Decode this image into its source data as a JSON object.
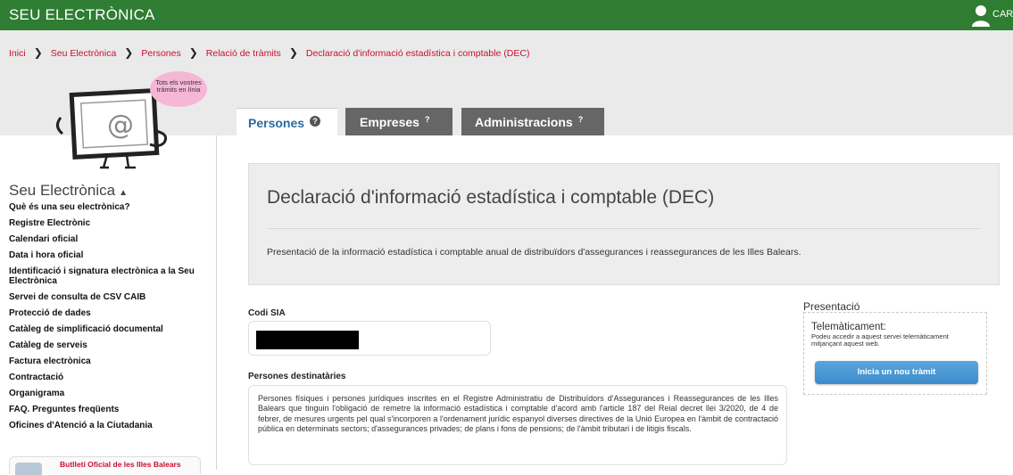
{
  "topbar": {
    "brand": "SEU ELECTRÒNICA",
    "user_label": "CAR",
    "user_icon": "user-silhouette-icon"
  },
  "breadcrumb": {
    "items": [
      "Inici",
      "Seu Electrònica",
      "Persones",
      "Relació de tràmits",
      "Declaració d'informació estadística i comptable (DEC)"
    ],
    "separator_icon": "chevron-right-icon"
  },
  "mascot": {
    "bubble_text": "Tots els vostres tràmits en línia",
    "icon": "computer-at-mascot-icon"
  },
  "tabs": [
    {
      "label": "Persones",
      "help": "?",
      "active": true
    },
    {
      "label": "Empreses",
      "help": "?",
      "active": false
    },
    {
      "label": "Administracions",
      "help": "?",
      "active": false
    }
  ],
  "sidebar": {
    "title": "Seu Electrònica",
    "title_caret": "▲",
    "items": [
      "Què és una seu electrònica?",
      "Registre Electrònic",
      "Calendari oficial",
      "Data i hora oficial",
      "Identificació i signatura electrònica a la Seu Electrònica",
      "Servei de consulta de CSV CAIB",
      "Protecció de dades",
      "Catàleg de simplificació documental",
      "Catàleg de serveis",
      "Factura electrònica",
      "Contractació",
      "Organigrama",
      "FAQ. Preguntes freqüents",
      "Oficines d'Atenció a la Ciutadania"
    ],
    "bulleti_label": "Butlletí Oficial de les Illes Balears"
  },
  "main": {
    "title": "Declaració d'informació estadística i comptable (DEC)",
    "description": "Presentació de la informació estadística i comptable anual de distribuïdors d'assegurances i reassegurances de les Illes Balears.",
    "codi_sia_label": "Codi SIA",
    "destinataries_label": "Persones destinatàries",
    "destinataries_text": "Persones físiques i persones jurídiques inscrites en el Registre Administratiu de Distribuïdors d'Assegurances i Reassegurances de les Illes Balears que tinguin l'obligació de remetre la informació estadística i comptable d'acord amb l'article 187 del Reial decret llei 3/2020, de 4 de febrer, de mesures urgents pel qual s'incorporen a l'ordenament jurídic espanyol diverses directives de la Unió Europea en l'àmbit de contractació pública en determinats sectors; d'assegurances privades; de plans i fons de pensions; de l'àmbit tributari i de litigis fiscals."
  },
  "presentacio": {
    "title": "Presentació",
    "tel_title": "Telemàticament:",
    "tel_desc": "Podeu accedir a aquest servei telemàticament mitjançant aquest web.",
    "button_label": "Inicia un nou tràmit"
  },
  "colors": {
    "topbar": "#2e7d32",
    "link_red": "#c8102e",
    "tab_active_text": "#2a6aa0",
    "tab_inactive": "#666666",
    "button_blue": "#3d8bcb"
  }
}
